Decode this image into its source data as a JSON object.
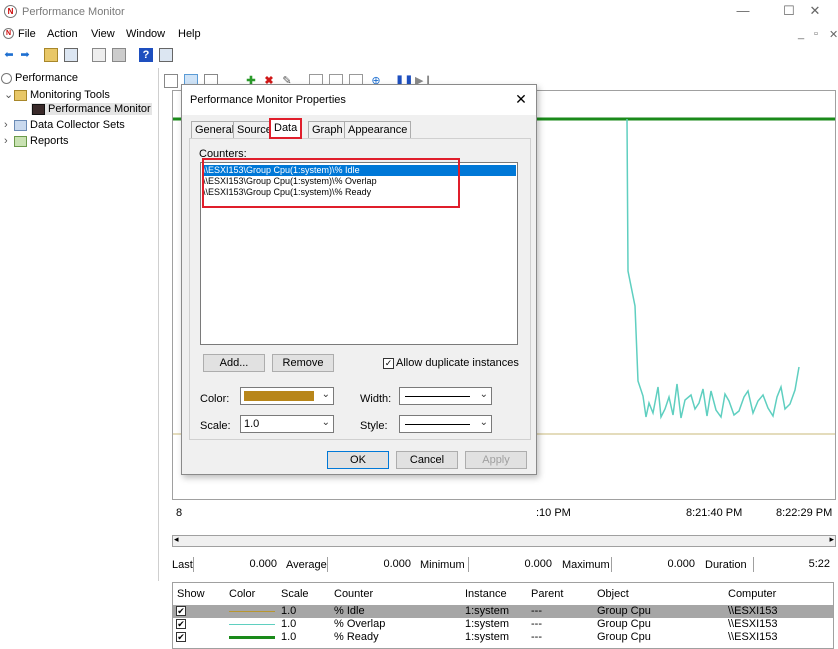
{
  "window": {
    "title": "Performance Monitor",
    "minimize": "—",
    "maximize": "☐",
    "close": "✕"
  },
  "menu": {
    "items": [
      "File",
      "Action",
      "View",
      "Window",
      "Help"
    ],
    "mdi_min": "_",
    "mdi_restore": "▫",
    "mdi_close": "✕"
  },
  "tree": {
    "root": "Performance",
    "monitoring_tools": "Monitoring Tools",
    "performance_monitor": "Performance Monitor",
    "data_collector_sets": "Data Collector Sets",
    "reports": "Reports"
  },
  "graph": {
    "x_ticks": [
      "8",
      ":10 PM",
      "8:21:40 PM",
      "8:22:29 PM"
    ]
  },
  "stats": {
    "last_label": "Last",
    "last_value": "0.000",
    "average_label": "Average",
    "average_value": "0.000",
    "minimum_label": "Minimum",
    "minimum_value": "0.000",
    "maximum_label": "Maximum",
    "maximum_value": "0.000",
    "duration_label": "Duration",
    "duration_value": "5:22"
  },
  "legend": {
    "headers": [
      "Show",
      "Color",
      "Scale",
      "Counter",
      "Instance",
      "Parent",
      "Object",
      "Computer"
    ],
    "rows": [
      {
        "color": "#b8962e",
        "scale": "1.0",
        "counter": "% Idle",
        "instance": "1:system",
        "parent": "---",
        "object": "Group Cpu",
        "computer": "\\\\ESXI153"
      },
      {
        "color": "#5fcfc0",
        "scale": "1.0",
        "counter": "% Overlap",
        "instance": "1:system",
        "parent": "---",
        "object": "Group Cpu",
        "computer": "\\\\ESXI153"
      },
      {
        "color": "#1a8a1a",
        "scale": "1.0",
        "counter": "% Ready",
        "instance": "1:system",
        "parent": "---",
        "object": "Group Cpu",
        "computer": "\\\\ESXI153"
      }
    ]
  },
  "dialog": {
    "title": "Performance Monitor Properties",
    "close": "✕",
    "tabs": [
      "General",
      "Source",
      "Data",
      "Graph",
      "Appearance"
    ],
    "active_tab": "Data",
    "counters_label": "Counters:",
    "counters": [
      "\\\\ESXI153\\Group Cpu(1:system)\\% Idle",
      "\\\\ESXI153\\Group Cpu(1:system)\\% Overlap",
      "\\\\ESXI153\\Group Cpu(1:system)\\% Ready"
    ],
    "add_button": "Add...",
    "remove_button": "Remove",
    "allow_duplicates_label": "Allow duplicate instances",
    "allow_duplicates_checked": "✓",
    "color_label": "Color:",
    "color_value": "#b8861a",
    "scale_label": "Scale:",
    "scale_value": "1.0",
    "width_label": "Width:",
    "style_label": "Style:",
    "ok_button": "OK",
    "cancel_button": "Cancel",
    "apply_button": "Apply"
  },
  "accent": "#e01e2b"
}
